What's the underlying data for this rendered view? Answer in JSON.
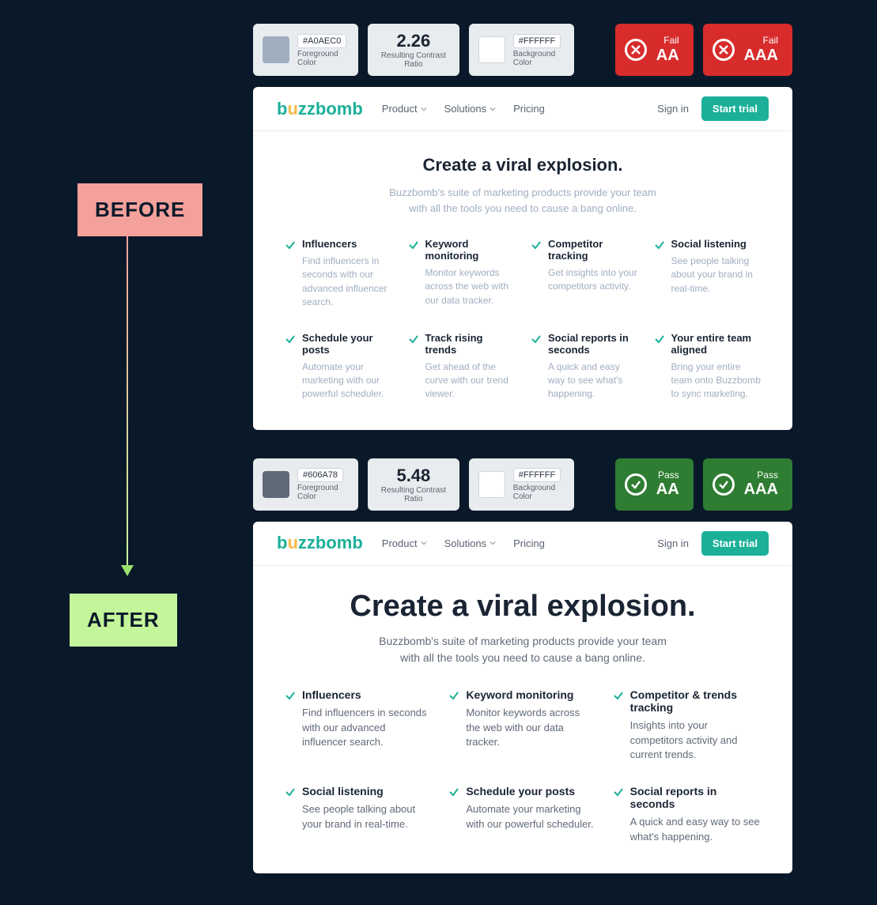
{
  "labels": {
    "before": "BEFORE",
    "after": "AFTER"
  },
  "before": {
    "fg_hex": "#A0AEC0",
    "fg_label": "Foreground Color",
    "ratio": "2.26",
    "ratio_label": "Resulting Contrast Ratio",
    "bg_hex": "#FFFFFF",
    "bg_label": "Background Color",
    "badge1_status": "Fail",
    "badge1_level": "AA",
    "badge2_status": "Fail",
    "badge2_level": "AAA",
    "logo": "buzzbomb",
    "nav1": "Product",
    "nav2": "Solutions",
    "nav3": "Pricing",
    "signin": "Sign in",
    "trial": "Start trial",
    "hero_title": "Create a viral explosion.",
    "hero_sub": "Buzzbomb's suite of marketing products provide your team with all the tools you need to cause a bang online.",
    "features": [
      {
        "title": "Influencers",
        "desc": "Find influencers in seconds with our advanced influencer search."
      },
      {
        "title": "Keyword monitoring",
        "desc": "Monitor keywords across the web with our data tracker."
      },
      {
        "title": "Competitor tracking",
        "desc": "Get insights into your competitors activity."
      },
      {
        "title": "Social listening",
        "desc": "See people talking about your brand in real-time."
      },
      {
        "title": "Schedule your posts",
        "desc": "Automate your marketing with our powerful scheduler."
      },
      {
        "title": "Track rising trends",
        "desc": "Get ahead of the curve with our trend viewer."
      },
      {
        "title": "Social reports in seconds",
        "desc": "A quick and easy way to see what's happening."
      },
      {
        "title": "Your entire team aligned",
        "desc": "Bring your entire team onto Buzzbomb to sync marketing."
      }
    ]
  },
  "after": {
    "fg_hex": "#606A78",
    "fg_label": "Foreground Color",
    "ratio": "5.48",
    "ratio_label": "Resulting Contrast Ratio",
    "bg_hex": "#FFFFFF",
    "bg_label": "Background Color",
    "badge1_status": "Pass",
    "badge1_level": "AA",
    "badge2_status": "Pass",
    "badge2_level": "AAA",
    "logo": "buzzbomb",
    "nav1": "Product",
    "nav2": "Solutions",
    "nav3": "Pricing",
    "signin": "Sign in",
    "trial": "Start trial",
    "hero_title": "Create a viral explosion.",
    "hero_sub": "Buzzbomb's suite of marketing products provide your team with all the tools you need to cause a bang online.",
    "features": [
      {
        "title": "Influencers",
        "desc": "Find influencers in seconds with our advanced influencer search."
      },
      {
        "title": "Keyword monitoring",
        "desc": "Monitor keywords across the web with our data tracker."
      },
      {
        "title": "Competitor & trends tracking",
        "desc": "Insights into your competitors activity and current trends."
      },
      {
        "title": "Social listening",
        "desc": "See people talking about your brand in real-time."
      },
      {
        "title": "Schedule your posts",
        "desc": "Automate your marketing with our powerful scheduler."
      },
      {
        "title": "Social reports in seconds",
        "desc": "A quick and easy way to see what's happening."
      }
    ]
  }
}
